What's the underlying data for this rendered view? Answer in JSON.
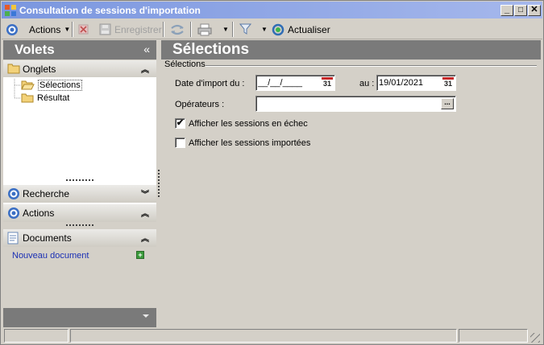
{
  "window": {
    "title": "Consultation de sessions d'importation",
    "min_label": "_",
    "max_label": "□",
    "close_label": "✕"
  },
  "toolbar": {
    "actions_label": "Actions",
    "save_label": "Enregistrer",
    "refresh_label": "Actualiser"
  },
  "left_panel": {
    "title": "Volets",
    "collapse_glyph": "«",
    "onglets_label": "Onglets",
    "tree_items": [
      "Sélections",
      "Résultat"
    ],
    "recherche_label": "Recherche",
    "actions_label": "Actions",
    "documents_label": "Documents",
    "new_doc_label": "Nouveau document"
  },
  "main": {
    "title": "Sélections",
    "group_label": "Sélections",
    "date_label": "Date d'import du :",
    "date_from_value": "__/__/____",
    "date_to_label": "au :",
    "date_to_value": "19/01/2021",
    "operators_label": "Opérateurs :",
    "operators_value": "",
    "calendar_glyph": "31",
    "ellipsis_glyph": "...",
    "check_failed_label": "Afficher les sessions en échec",
    "check_failed_checked": true,
    "check_imported_label": "Afficher les sessions importées",
    "check_imported_checked": false
  },
  "colors": {
    "titlebar_start": "#7a96df",
    "header_gray": "#7a7a7a",
    "link_blue": "#1a2fb4"
  }
}
